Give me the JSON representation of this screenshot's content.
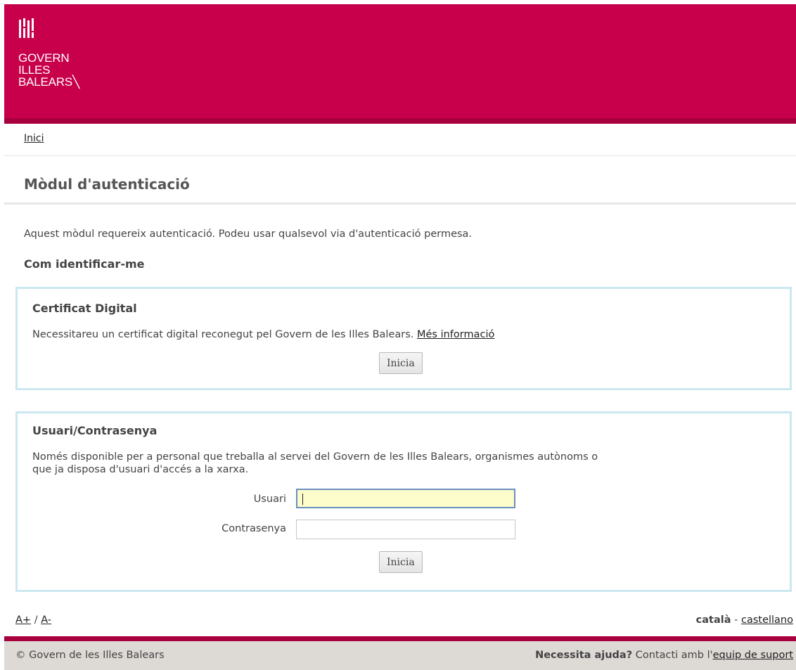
{
  "header": {
    "logo_lines": [
      "GOVERN",
      "ILLES",
      "BALEARS╲"
    ],
    "colors": {
      "brand": "#c8004b",
      "brand_dark": "#a8003c"
    }
  },
  "breadcrumb": {
    "home": "Inici"
  },
  "page": {
    "title": "Mòdul d'autenticació",
    "intro": "Aquest mòdul requereix autenticació. Podeu usar qualsevol via d'autenticació permesa.",
    "how_title": "Com identificar-me"
  },
  "certificate": {
    "title": "Certificat Digital",
    "description": "Necessitareu un certificat digital reconegut pel Govern de les Illes Balears.",
    "more_info": "Més informació",
    "button": "Inicia"
  },
  "userpass": {
    "title": "Usuari/Contrasenya",
    "description_line1": "Només disponible per a personal que treballa al servei del Govern de les Illes Balears, organismes autònoms o",
    "description_line2": "que ja disposa d'usuari d'accés a la xarxa.",
    "user_label": "Usuari",
    "user_value": "",
    "password_label": "Contrasenya",
    "password_value": "",
    "button": "Inicia"
  },
  "footer": {
    "font_increase": "A+",
    "font_separator": "/",
    "font_decrease": "A-",
    "lang_current": "català",
    "lang_separator": "-",
    "lang_other": "castellano",
    "copyright": "© Govern de les Illes Balears",
    "help_bold": "Necessita ajuda?",
    "help_text": "Contacti amb l'",
    "help_link": "equip de suport"
  }
}
